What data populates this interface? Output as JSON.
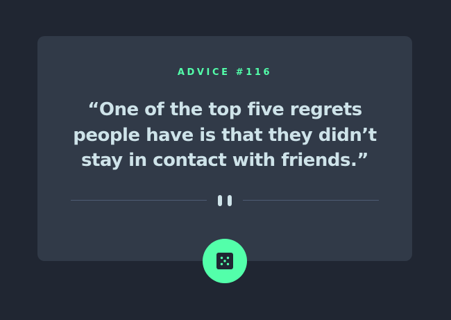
{
  "card": {
    "advice_label": "ADVICE #116",
    "quote": "“One of the top five regrets people have is that they didn’t stay in contact with friends.”"
  },
  "divider": {
    "icon": "pause-icon"
  },
  "dice_button": {
    "icon": "dice-icon"
  },
  "colors": {
    "background": "#202632",
    "card": "#313a48",
    "accent": "#53ffaa",
    "quote_text": "#cee3e9",
    "divider": "#4f5d74"
  }
}
